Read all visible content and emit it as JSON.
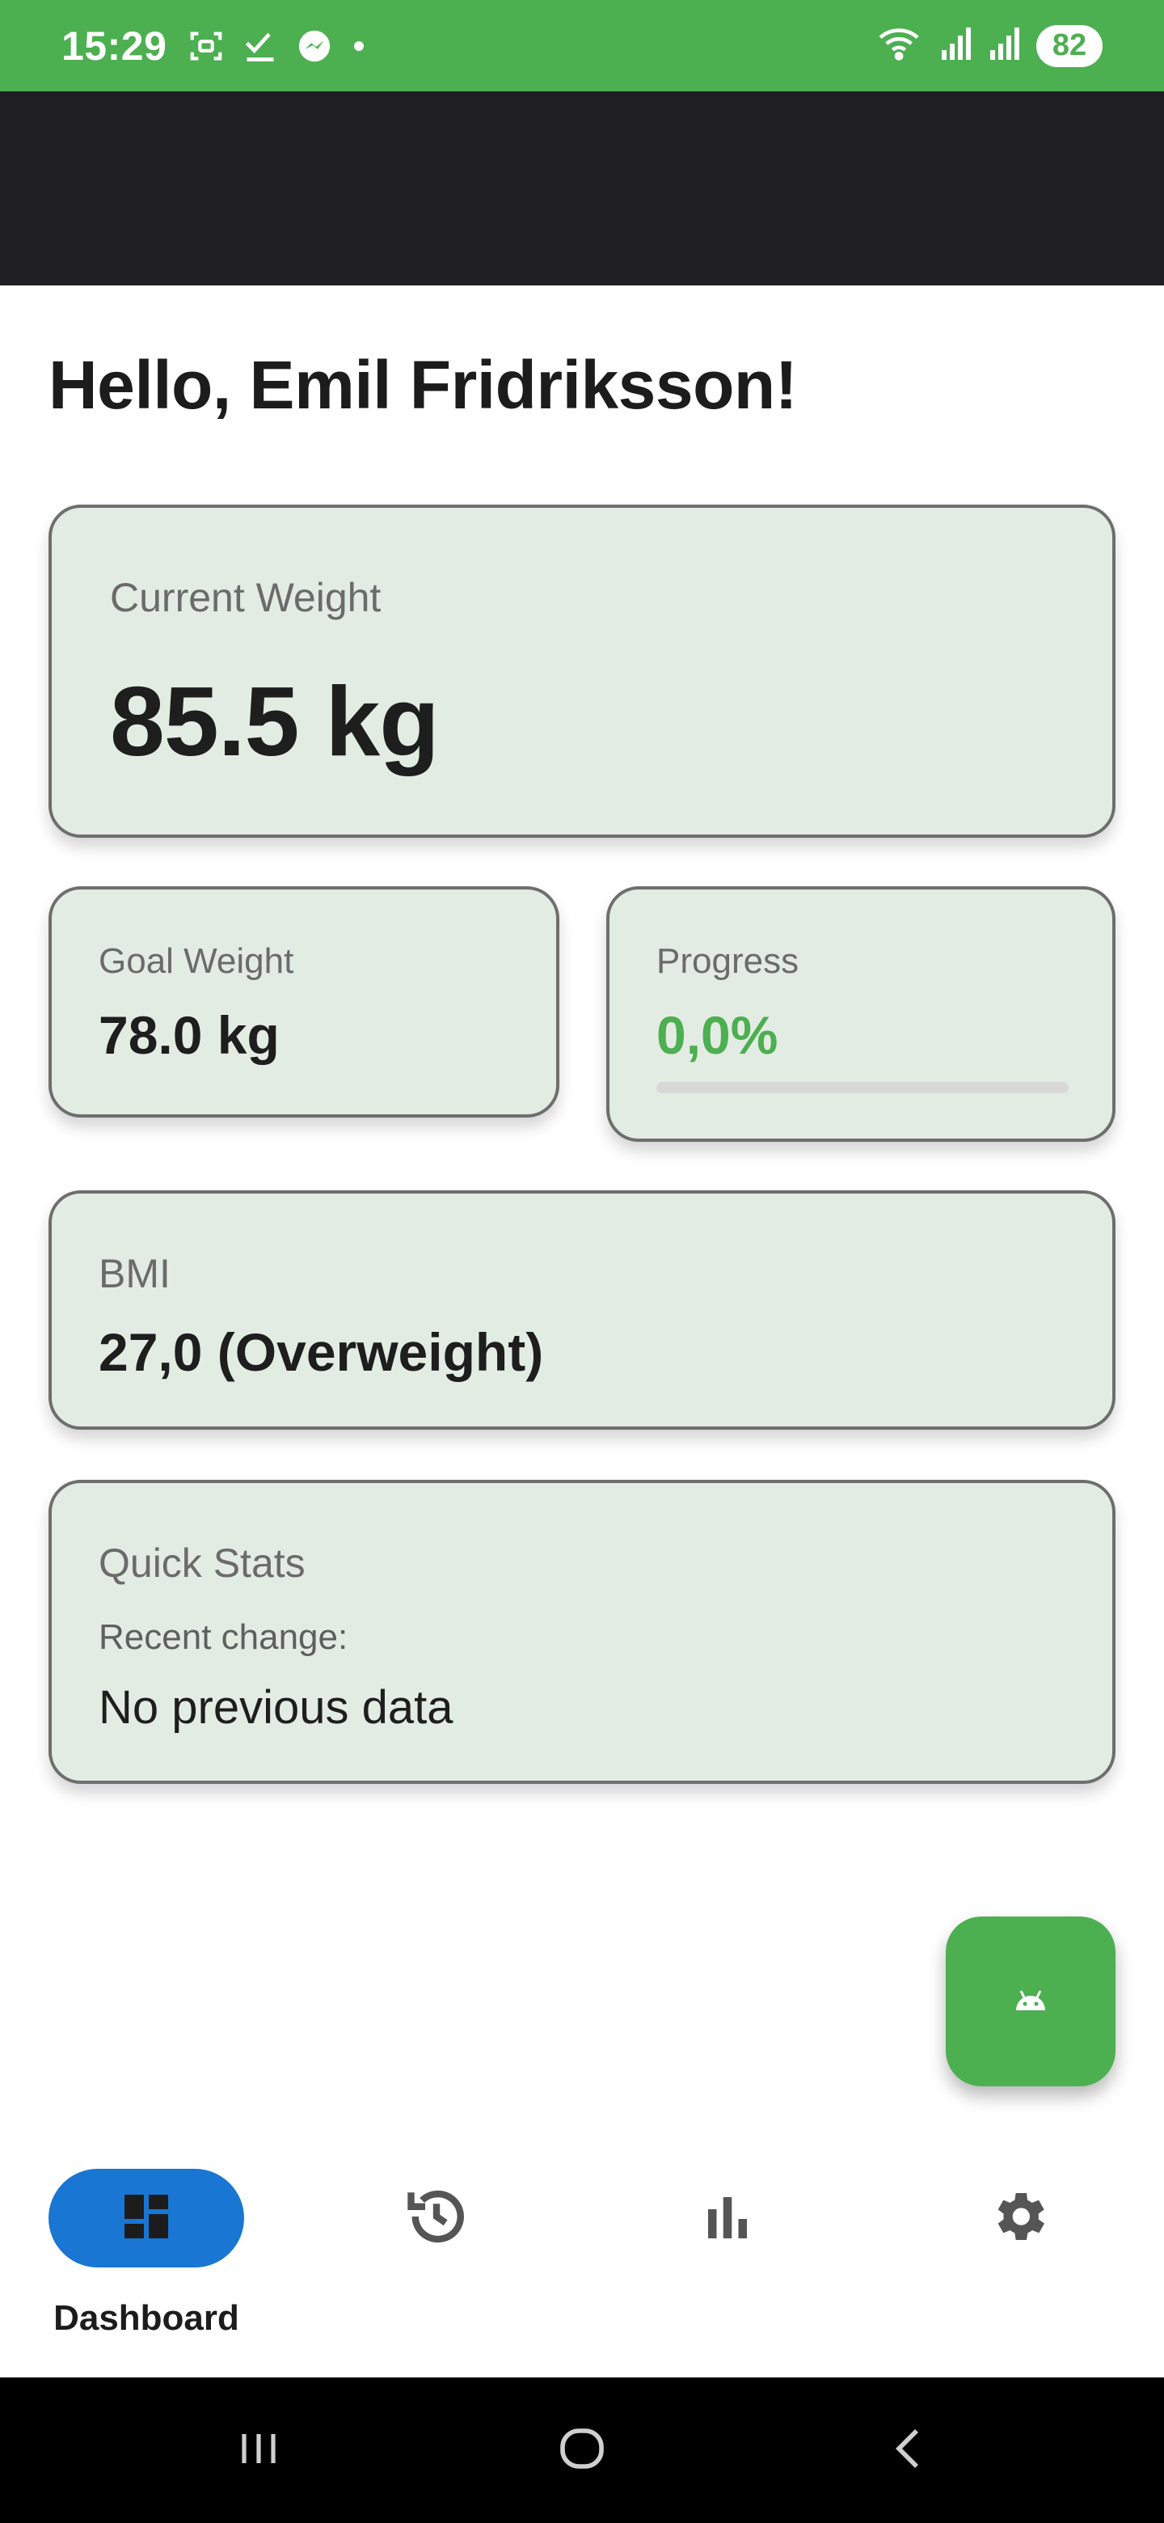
{
  "status_bar": {
    "time": "15:29",
    "battery": "82",
    "left_icons": [
      "screenshot-icon",
      "checkmark-icon",
      "messenger-icon",
      "dot-icon"
    ],
    "right_icons": [
      "wifi-icon",
      "signal-icon",
      "signal-roaming-icon"
    ]
  },
  "greeting": "Hello, Emil Fridriksson!",
  "current_weight": {
    "label": "Current Weight",
    "value": "85.5 kg"
  },
  "goal_weight": {
    "label": "Goal Weight",
    "value": "78.0 kg"
  },
  "progress": {
    "label": "Progress",
    "value": "0,0%",
    "fraction": 0.0
  },
  "bmi": {
    "label": "BMI",
    "value": "27,0 (Overweight)"
  },
  "quick_stats": {
    "label": "Quick Stats",
    "sub_label": "Recent change:",
    "text": "No previous data"
  },
  "fab": {
    "icon": "android-icon"
  },
  "bottom_nav": {
    "items": [
      {
        "label": "Dashboard",
        "icon": "dashboard-icon",
        "selected": true
      },
      {
        "label": "",
        "icon": "history-icon",
        "selected": false
      },
      {
        "label": "",
        "icon": "bar-chart-icon",
        "selected": false
      },
      {
        "label": "",
        "icon": "settings-gear-icon",
        "selected": false
      }
    ]
  },
  "system_nav": {
    "icons": [
      "recent-apps-icon",
      "home-icon",
      "back-icon"
    ]
  },
  "colors": {
    "primary_green": "#4caf50",
    "app_bar": "#1f1f23",
    "card_bg": "#e3ece3",
    "nav_selected": "#1976d2"
  }
}
